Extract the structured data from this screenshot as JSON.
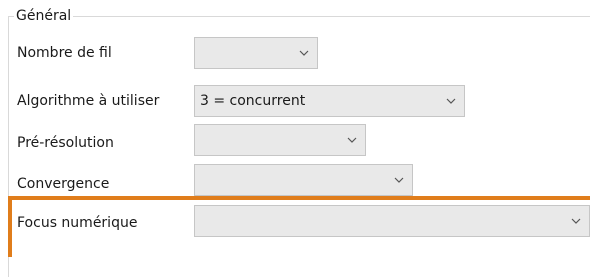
{
  "group": {
    "title": "Général"
  },
  "rows": [
    {
      "label": "Nombre de fil",
      "value": ""
    },
    {
      "label": "Algorithme à utiliser",
      "value": "3 = concurrent"
    },
    {
      "label": "Pré-résolution",
      "value": ""
    },
    {
      "label": "Convergence",
      "value": ""
    },
    {
      "label": "Focus numérique",
      "value": ""
    }
  ],
  "icons": {
    "dropdown": "chevron-down-icon"
  },
  "colors": {
    "highlight": "#e07d1b",
    "combo_bg": "#e9e9e9",
    "combo_border": "#c6c6c6"
  }
}
